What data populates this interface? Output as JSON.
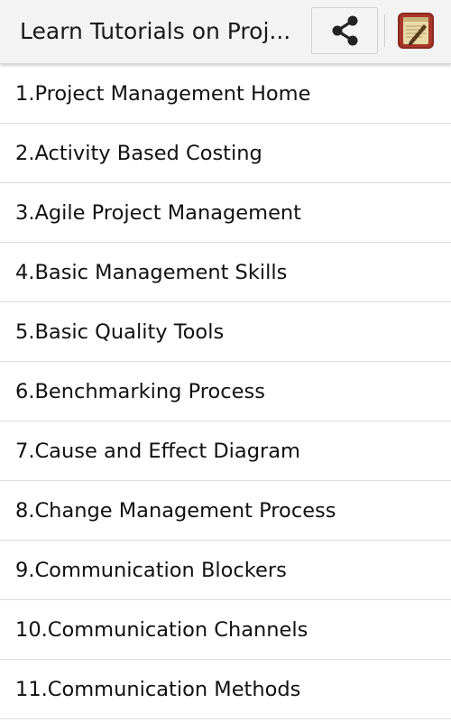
{
  "app_bar": {
    "title": "Learn Tutorials on Proj...",
    "share_icon": "share-icon",
    "app_icon": "notebook-icon"
  },
  "colors": {
    "app_bar_bg": "#f3f3f3",
    "divider": "#dcdcdc",
    "text": "#111111",
    "app_icon_frame": "#8b2a1f",
    "app_icon_paper": "#e9d9a8"
  },
  "list": {
    "items": [
      {
        "label": "1.Project Management Home"
      },
      {
        "label": "2.Activity Based Costing"
      },
      {
        "label": "3.Agile Project Management"
      },
      {
        "label": "4.Basic Management Skills"
      },
      {
        "label": "5.Basic Quality Tools"
      },
      {
        "label": "6.Benchmarking Process"
      },
      {
        "label": "7.Cause and Effect Diagram"
      },
      {
        "label": "8.Change Management Process"
      },
      {
        "label": "9.Communication Blockers"
      },
      {
        "label": "10.Communication Channels"
      },
      {
        "label": "11.Communication Methods"
      }
    ]
  }
}
